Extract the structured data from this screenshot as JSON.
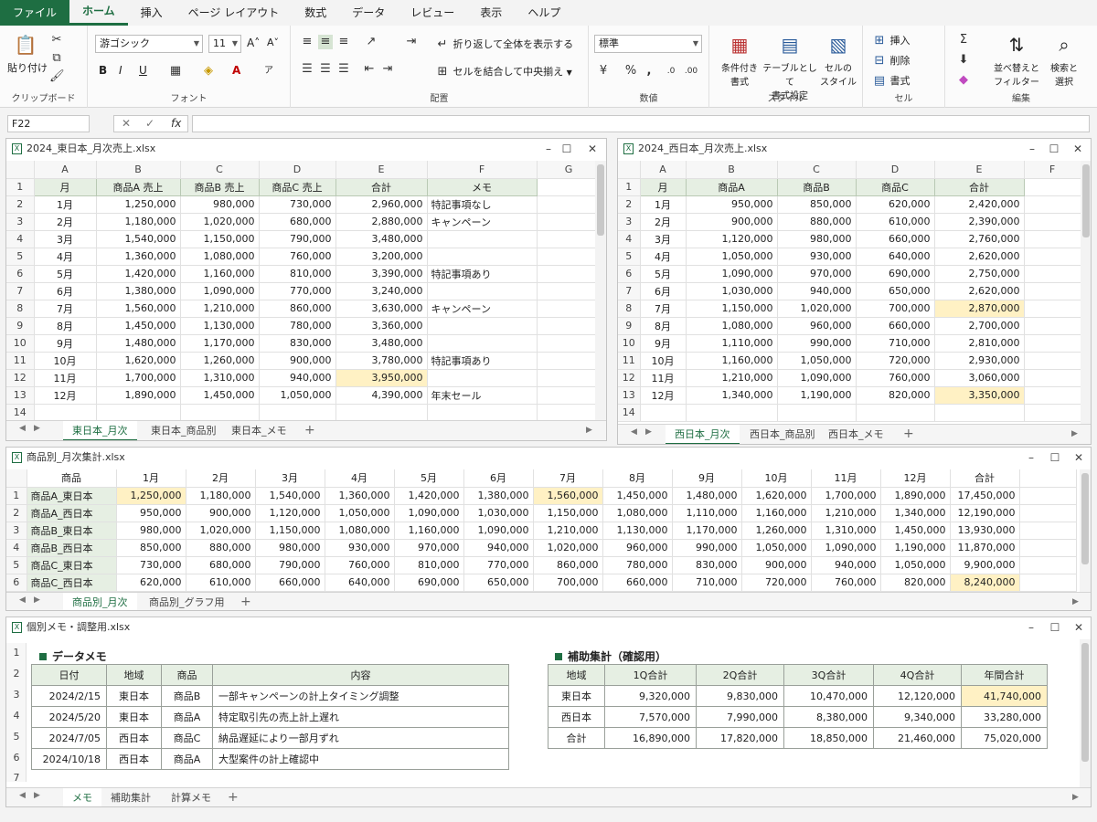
{
  "ribbon_tabs": [
    "ファイル",
    "ホーム",
    "挿入",
    "ページ レイアウト",
    "数式",
    "データ",
    "レビュー",
    "表示",
    "ヘルプ"
  ],
  "ribbon": {
    "paste": "貼り付け",
    "clipboard": "クリップボード",
    "font_name": "游ゴシック",
    "font_size": "11",
    "font_group": "フォント",
    "wrap": "折り返して全体を表示する",
    "merge": "セルを結合して中央揃え",
    "align_group": "配置",
    "number_format": "標準",
    "number_group": "数値",
    "cond_format": "条件付き\n書式",
    "table_format": "テーブルとして\n書式設定",
    "cell_style": "セルの\nスタイル",
    "style_group": "スタイル",
    "insert": "挿入",
    "delete": "削除",
    "format": "書式",
    "cells_group": "セル",
    "sort": "並べ替えと\nフィルター",
    "find": "検索と\n選択",
    "edit_group": "編集"
  },
  "namebox": "F22",
  "win1": {
    "title": "2024_東日本_月次売上.xlsx",
    "cols": [
      "A",
      "B",
      "C",
      "D",
      "E",
      "F",
      "G"
    ],
    "headers": [
      "月",
      "商品A 売上",
      "商品B 売上",
      "商品C 売上",
      "合計",
      "メモ"
    ],
    "rows": [
      [
        "1月",
        "1,250,000",
        "980,000",
        "730,000",
        "2,960,000",
        "特記事項なし"
      ],
      [
        "2月",
        "1,180,000",
        "1,020,000",
        "680,000",
        "2,880,000",
        "キャンペーン"
      ],
      [
        "3月",
        "1,540,000",
        "1,150,000",
        "790,000",
        "3,480,000",
        ""
      ],
      [
        "4月",
        "1,360,000",
        "1,080,000",
        "760,000",
        "3,200,000",
        ""
      ],
      [
        "5月",
        "1,420,000",
        "1,160,000",
        "810,000",
        "3,390,000",
        "特記事項あり"
      ],
      [
        "6月",
        "1,380,000",
        "1,090,000",
        "770,000",
        "3,240,000",
        ""
      ],
      [
        "7月",
        "1,560,000",
        "1,210,000",
        "860,000",
        "3,630,000",
        "キャンペーン"
      ],
      [
        "8月",
        "1,450,000",
        "1,130,000",
        "780,000",
        "3,360,000",
        ""
      ],
      [
        "9月",
        "1,480,000",
        "1,170,000",
        "830,000",
        "3,480,000",
        ""
      ],
      [
        "10月",
        "1,620,000",
        "1,260,000",
        "900,000",
        "3,780,000",
        "特記事項あり"
      ],
      [
        "11月",
        "1,700,000",
        "1,310,000",
        "940,000",
        "3,950,000",
        ""
      ],
      [
        "12月",
        "1,890,000",
        "1,450,000",
        "1,050,000",
        "4,390,000",
        "年末セール"
      ]
    ],
    "tabs": [
      "東日本_月次",
      "東日本_商品別",
      "東日本_メモ"
    ]
  },
  "win2": {
    "title": "2024_西日本_月次売上.xlsx",
    "cols": [
      "A",
      "B",
      "C",
      "D",
      "E",
      "F"
    ],
    "headers": [
      "月",
      "商品A",
      "商品B",
      "商品C",
      "合計"
    ],
    "rows": [
      [
        "1月",
        "950,000",
        "850,000",
        "620,000",
        "2,420,000"
      ],
      [
        "2月",
        "900,000",
        "880,000",
        "610,000",
        "2,390,000"
      ],
      [
        "3月",
        "1,120,000",
        "980,000",
        "660,000",
        "2,760,000"
      ],
      [
        "4月",
        "1,050,000",
        "930,000",
        "640,000",
        "2,620,000"
      ],
      [
        "5月",
        "1,090,000",
        "970,000",
        "690,000",
        "2,750,000"
      ],
      [
        "6月",
        "1,030,000",
        "940,000",
        "650,000",
        "2,620,000"
      ],
      [
        "7月",
        "1,150,000",
        "1,020,000",
        "700,000",
        "2,870,000"
      ],
      [
        "8月",
        "1,080,000",
        "960,000",
        "660,000",
        "2,700,000"
      ],
      [
        "9月",
        "1,110,000",
        "990,000",
        "710,000",
        "2,810,000"
      ],
      [
        "10月",
        "1,160,000",
        "1,050,000",
        "720,000",
        "2,930,000"
      ],
      [
        "11月",
        "1,210,000",
        "1,090,000",
        "760,000",
        "3,060,000"
      ],
      [
        "12月",
        "1,340,000",
        "1,190,000",
        "820,000",
        "3,350,000"
      ]
    ],
    "tabs": [
      "西日本_月次",
      "西日本_商品別",
      "西日本_メモ"
    ]
  },
  "win3": {
    "title": "商品別_月次集計.xlsx",
    "headers": [
      "商品",
      "1月",
      "2月",
      "3月",
      "4月",
      "5月",
      "6月",
      "7月",
      "8月",
      "9月",
      "10月",
      "11月",
      "12月",
      "合計"
    ],
    "rows": [
      [
        "商品A_東日本",
        "1,250,000",
        "1,180,000",
        "1,540,000",
        "1,360,000",
        "1,420,000",
        "1,380,000",
        "1,560,000",
        "1,450,000",
        "1,480,000",
        "1,620,000",
        "1,700,000",
        "1,890,000",
        "17,450,000"
      ],
      [
        "商品A_西日本",
        "950,000",
        "900,000",
        "1,120,000",
        "1,050,000",
        "1,090,000",
        "1,030,000",
        "1,150,000",
        "1,080,000",
        "1,110,000",
        "1,160,000",
        "1,210,000",
        "1,340,000",
        "12,190,000"
      ],
      [
        "商品B_東日本",
        "980,000",
        "1,020,000",
        "1,150,000",
        "1,080,000",
        "1,160,000",
        "1,090,000",
        "1,210,000",
        "1,130,000",
        "1,170,000",
        "1,260,000",
        "1,310,000",
        "1,450,000",
        "13,930,000"
      ],
      [
        "商品B_西日本",
        "850,000",
        "880,000",
        "980,000",
        "930,000",
        "970,000",
        "940,000",
        "1,020,000",
        "960,000",
        "990,000",
        "1,050,000",
        "1,090,000",
        "1,190,000",
        "11,870,000"
      ],
      [
        "商品C_東日本",
        "730,000",
        "680,000",
        "790,000",
        "760,000",
        "810,000",
        "770,000",
        "860,000",
        "780,000",
        "830,000",
        "900,000",
        "940,000",
        "1,050,000",
        "9,900,000"
      ],
      [
        "商品C_西日本",
        "620,000",
        "610,000",
        "660,000",
        "640,000",
        "690,000",
        "650,000",
        "700,000",
        "660,000",
        "710,000",
        "720,000",
        "760,000",
        "820,000",
        "8,240,000"
      ]
    ],
    "tabs": [
      "商品別_月次",
      "商品別_グラフ用"
    ]
  },
  "win4": {
    "title": "個別メモ・調整用.xlsx",
    "memo_title": "データメモ",
    "memo_headers": [
      "日付",
      "地域",
      "商品",
      "内容"
    ],
    "memo_rows": [
      [
        "2024/2/15",
        "東日本",
        "商品B",
        "一部キャンペーンの計上タイミング調整"
      ],
      [
        "2024/5/20",
        "東日本",
        "商品A",
        "特定取引先の売上計上遅れ"
      ],
      [
        "2024/7/05",
        "西日本",
        "商品C",
        "納品遅延により一部月ずれ"
      ],
      [
        "2024/10/18",
        "西日本",
        "商品A",
        "大型案件の計上確認中"
      ]
    ],
    "agg_title": "補助集計（確認用）",
    "agg_headers": [
      "地域",
      "1Q合計",
      "2Q合計",
      "3Q合計",
      "4Q合計",
      "年間合計"
    ],
    "agg_rows": [
      [
        "東日本",
        "9,320,000",
        "9,830,000",
        "10,470,000",
        "12,120,000",
        "41,740,000"
      ],
      [
        "西日本",
        "7,570,000",
        "7,990,000",
        "8,380,000",
        "9,340,000",
        "33,280,000"
      ],
      [
        "合計",
        "16,890,000",
        "17,820,000",
        "18,850,000",
        "21,460,000",
        "75,020,000"
      ]
    ],
    "tabs": [
      "メモ",
      "補助集計",
      "計算メモ"
    ]
  },
  "accent_color": "#1e6e42",
  "highlight_color": "#fff1c4",
  "header_fill": "#e6efe3"
}
